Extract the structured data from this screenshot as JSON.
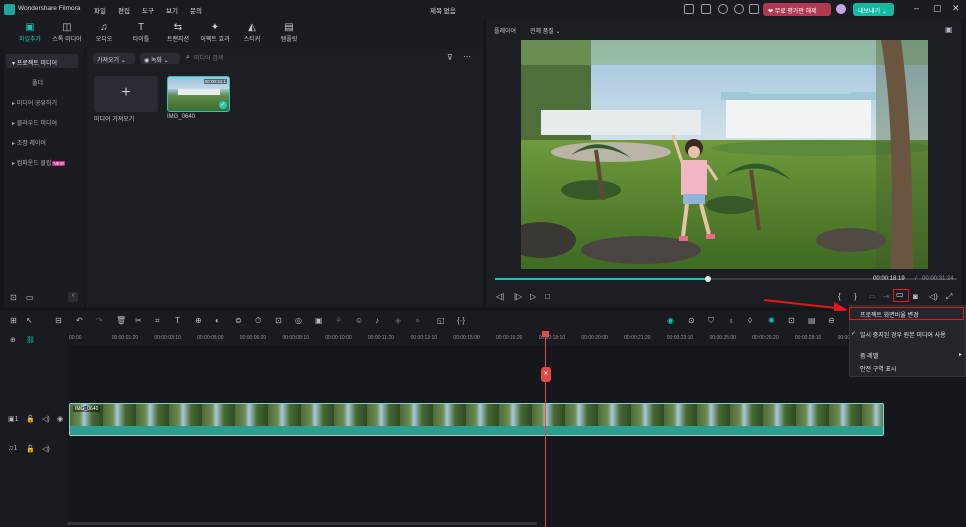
{
  "titlebar": {
    "app_name": "Wondershare Filmora",
    "menu": [
      "파일",
      "편집",
      "도구",
      "보기",
      "문의"
    ],
    "project_title": "제목 없음",
    "upgrade_label": "무료 평가판 해제",
    "export_label": "내보내기",
    "window_controls": [
      "–",
      "▢",
      "✕"
    ]
  },
  "media_tabs": [
    {
      "label": "파일추가",
      "icon": "folder-icon"
    },
    {
      "label": "스톡 미디어",
      "icon": "stock-media-icon"
    },
    {
      "label": "오디오",
      "icon": "music-note-icon"
    },
    {
      "label": "타이틀",
      "icon": "text-icon"
    },
    {
      "label": "트랜지션",
      "icon": "transition-icon"
    },
    {
      "label": "이펙트 효과",
      "icon": "effects-icon"
    },
    {
      "label": "스티커",
      "icon": "sticker-icon"
    },
    {
      "label": "템플릿",
      "icon": "template-icon"
    }
  ],
  "leftnav": {
    "items": [
      "프로젝트 미디어",
      "폴더",
      "미디어 공유하기",
      "클라우드 미디어",
      "조정 레이어",
      "컴파운드 클립"
    ],
    "new_badge": "NEW"
  },
  "library": {
    "sort_label": "가져오기",
    "record_label": "녹화",
    "search_placeholder": "미디어 검색",
    "import_label": "미디어 가져오기",
    "clip_name": "IMG_0640",
    "clip_duration": "00:00:31:1"
  },
  "player": {
    "label": "플레이어",
    "quality": "전체 품질",
    "current_time": "00:00:18:19",
    "separator": "/",
    "total_time": "00:00:31:24",
    "progress": 0.461
  },
  "ruler_ticks": [
    "00:00",
    "00:00:01:20",
    "00:00:03:10",
    "00:00:05:00",
    "00:00:06:20",
    "00:00:08:10",
    "00:00:10:00",
    "00:00:11:20",
    "00:00:13:10",
    "00:00:15:00",
    "00:00:16:20",
    "00:00:18:10",
    "00:00:20:00",
    "00:00:21:20",
    "00:00:23:10",
    "00:00:25:00",
    "00:00:26:20",
    "00:00:28:10",
    "00:00:30:"
  ],
  "timeline": {
    "clip_label": "IMG_0640",
    "video_track_label": "1",
    "audio_track_label": "1"
  },
  "context_menu": {
    "items": [
      {
        "label": "프로젝트 화면비율 변경",
        "checked": false
      },
      {
        "label": "일시 중지된 경우 원본 미디어 사용",
        "checked": true
      },
      {
        "label": "줌 레벨",
        "submenu": true
      },
      {
        "label": "안전 구역 표시",
        "checked": false
      }
    ]
  },
  "colors": {
    "accent": "#19c2af",
    "playhead": "#e24a4a",
    "highlight": "#e01919"
  }
}
